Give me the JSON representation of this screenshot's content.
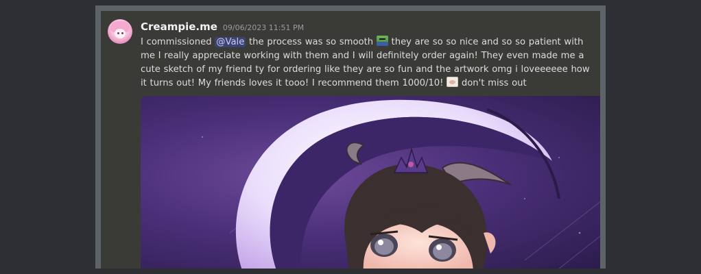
{
  "message": {
    "username": "Creampie.me",
    "timestamp": "09/06/2023 11:51 PM",
    "text_part1": "I commissioned ",
    "mention": "@Vale",
    "text_part2": " the process was so smooth ",
    "text_part3": " they are so so nice and so so patient with me I really appreciate working with them and I will definitely order again! They even made me a cute sketch of my friend ty for ordering like they are so fun and the artwork omg i loveeeeee how it turns out! My friends loves it tooo! I recommend them 1000/10! ",
    "text_part4": " don't miss out",
    "emoji1": "pepe-emoji",
    "emoji2": "sketch-emoji"
  },
  "colors": {
    "background": "#2e2f33",
    "frame": "#5c6468",
    "message_bg": "#3a3a37",
    "username": "#f2f3f5",
    "text": "#dcddde",
    "mention_bg": "#3d4270",
    "mention_text": "#c9cdfb"
  }
}
